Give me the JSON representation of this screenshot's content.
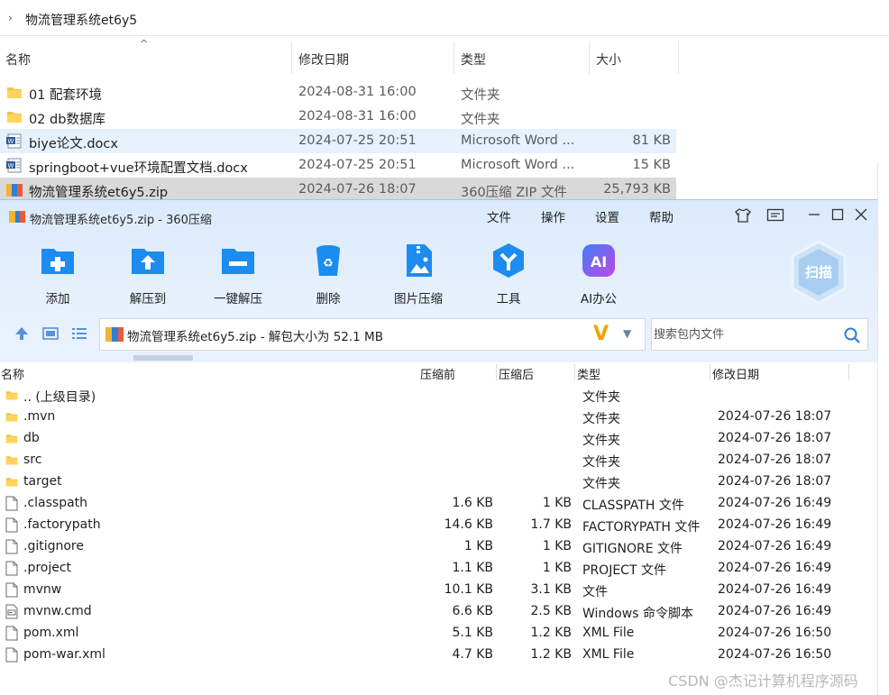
{
  "explorer": {
    "breadcrumb": "物流管理系统et6y5",
    "columns": {
      "name": "名称",
      "date": "修改日期",
      "type": "类型",
      "size": "大小"
    },
    "files": [
      {
        "name": "01 配套环境",
        "date": "2024-08-31 16:00",
        "type": "文件夹",
        "size": "",
        "icon": "folder-icon"
      },
      {
        "name": "02 db数据库",
        "date": "2024-08-31 16:00",
        "type": "文件夹",
        "size": "",
        "icon": "folder-icon"
      },
      {
        "name": "biye论文.docx",
        "date": "2024-07-25 20:51",
        "type": "Microsoft Word ...",
        "size": "81 KB",
        "icon": "word-doc-icon"
      },
      {
        "name": "springboot+vue环境配置文档.docx",
        "date": "2024-07-25 20:51",
        "type": "Microsoft Word ...",
        "size": "15 KB",
        "icon": "word-doc-icon"
      },
      {
        "name": "物流管理系统et6y5.zip",
        "date": "2024-07-26 18:07",
        "type": "360压缩 ZIP 文件",
        "size": "25,793 KB",
        "icon": "zip-archive-icon"
      }
    ]
  },
  "zip": {
    "title": "物流管理系统et6y5.zip - 360压缩",
    "menu": [
      "文件",
      "操作",
      "设置",
      "帮助"
    ],
    "toolbar": [
      "添加",
      "解压到",
      "一键解压",
      "删除",
      "图片压缩",
      "工具",
      "AI办公"
    ],
    "scan_label": "扫描",
    "address": "物流管理系统et6y5.zip - 解包大小为 52.1 MB",
    "search_placeholder": "搜索包内文件",
    "columns": {
      "name": "名称",
      "compressed_before": "压缩前",
      "compressed_after": "压缩后",
      "type": "类型",
      "modified": "修改日期"
    },
    "entries": [
      {
        "name": ".. (上级目录)",
        "before": "",
        "after": "",
        "type": "文件夹",
        "date": "",
        "icon": "folder-icon"
      },
      {
        "name": ".mvn",
        "before": "",
        "after": "",
        "type": "文件夹",
        "date": "2024-07-26 18:07",
        "icon": "folder-icon"
      },
      {
        "name": "db",
        "before": "",
        "after": "",
        "type": "文件夹",
        "date": "2024-07-26 18:07",
        "icon": "folder-icon"
      },
      {
        "name": "src",
        "before": "",
        "after": "",
        "type": "文件夹",
        "date": "2024-07-26 18:07",
        "icon": "folder-icon"
      },
      {
        "name": "target",
        "before": "",
        "after": "",
        "type": "文件夹",
        "date": "2024-07-26 18:07",
        "icon": "folder-icon"
      },
      {
        "name": ".classpath",
        "before": "1.6 KB",
        "after": "1 KB",
        "type": "CLASSPATH 文件",
        "date": "2024-07-26 16:49",
        "icon": "file-icon"
      },
      {
        "name": ".factorypath",
        "before": "14.6 KB",
        "after": "1.7 KB",
        "type": "FACTORYPATH 文件",
        "date": "2024-07-26 16:49",
        "icon": "file-icon"
      },
      {
        "name": ".gitignore",
        "before": "1 KB",
        "after": "1 KB",
        "type": "GITIGNORE 文件",
        "date": "2024-07-26 16:49",
        "icon": "file-icon"
      },
      {
        "name": ".project",
        "before": "1.1 KB",
        "after": "1 KB",
        "type": "PROJECT 文件",
        "date": "2024-07-26 16:49",
        "icon": "file-icon"
      },
      {
        "name": "mvnw",
        "before": "10.1 KB",
        "after": "3.1 KB",
        "type": "文件",
        "date": "2024-07-26 16:49",
        "icon": "file-icon"
      },
      {
        "name": "mvnw.cmd",
        "before": "6.6 KB",
        "after": "2.5 KB",
        "type": "Windows 命令脚本",
        "date": "2024-07-26 16:49",
        "icon": "script-file-icon"
      },
      {
        "name": "pom.xml",
        "before": "5.1 KB",
        "after": "1.2 KB",
        "type": "XML File",
        "date": "2024-07-26 16:50",
        "icon": "file-icon"
      },
      {
        "name": "pom-war.xml",
        "before": "4.7 KB",
        "after": "1.2 KB",
        "type": "XML File",
        "date": "2024-07-26 16:50",
        "icon": "file-icon"
      }
    ]
  },
  "watermark": "CSDN @杰记计算机程序源码",
  "colors": {
    "accent": "#1d8cf0",
    "folder": "#f5c242",
    "toolbar_bg": "#dbeafb",
    "selection": "#e5f1fb"
  }
}
